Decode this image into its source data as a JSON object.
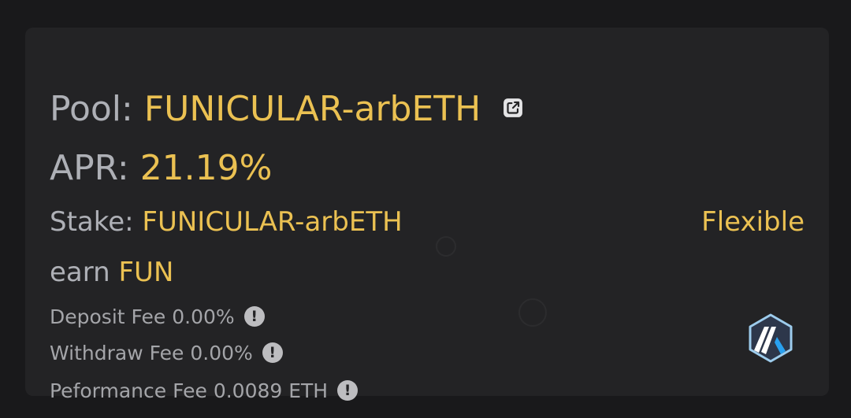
{
  "pool": {
    "label": "Pool:",
    "name": "FUNICULAR-arbETH",
    "link_icon": "external-link-icon"
  },
  "apr": {
    "label": "APR:",
    "value": "21.19%"
  },
  "stake": {
    "label": "Stake:",
    "token": "FUNICULAR-arbETH",
    "mode": "Flexible"
  },
  "earn": {
    "label": "earn",
    "token": "FUN"
  },
  "fees": {
    "deposit": "Deposit Fee 0.00%",
    "withdraw": "Withdraw Fee 0.00%",
    "performance": "Peformance Fee 0.0089 ETH",
    "info_icon": "info-icon",
    "info_glyph": "!"
  },
  "network": {
    "logo_icon": "arbitrum-logo-icon"
  },
  "colors": {
    "page_background": "#19191b",
    "card_background": "#232325",
    "label_gray": "#aeb0b6",
    "accent_gold": "#ebc152",
    "fee_gray": "#a4a5a9"
  }
}
